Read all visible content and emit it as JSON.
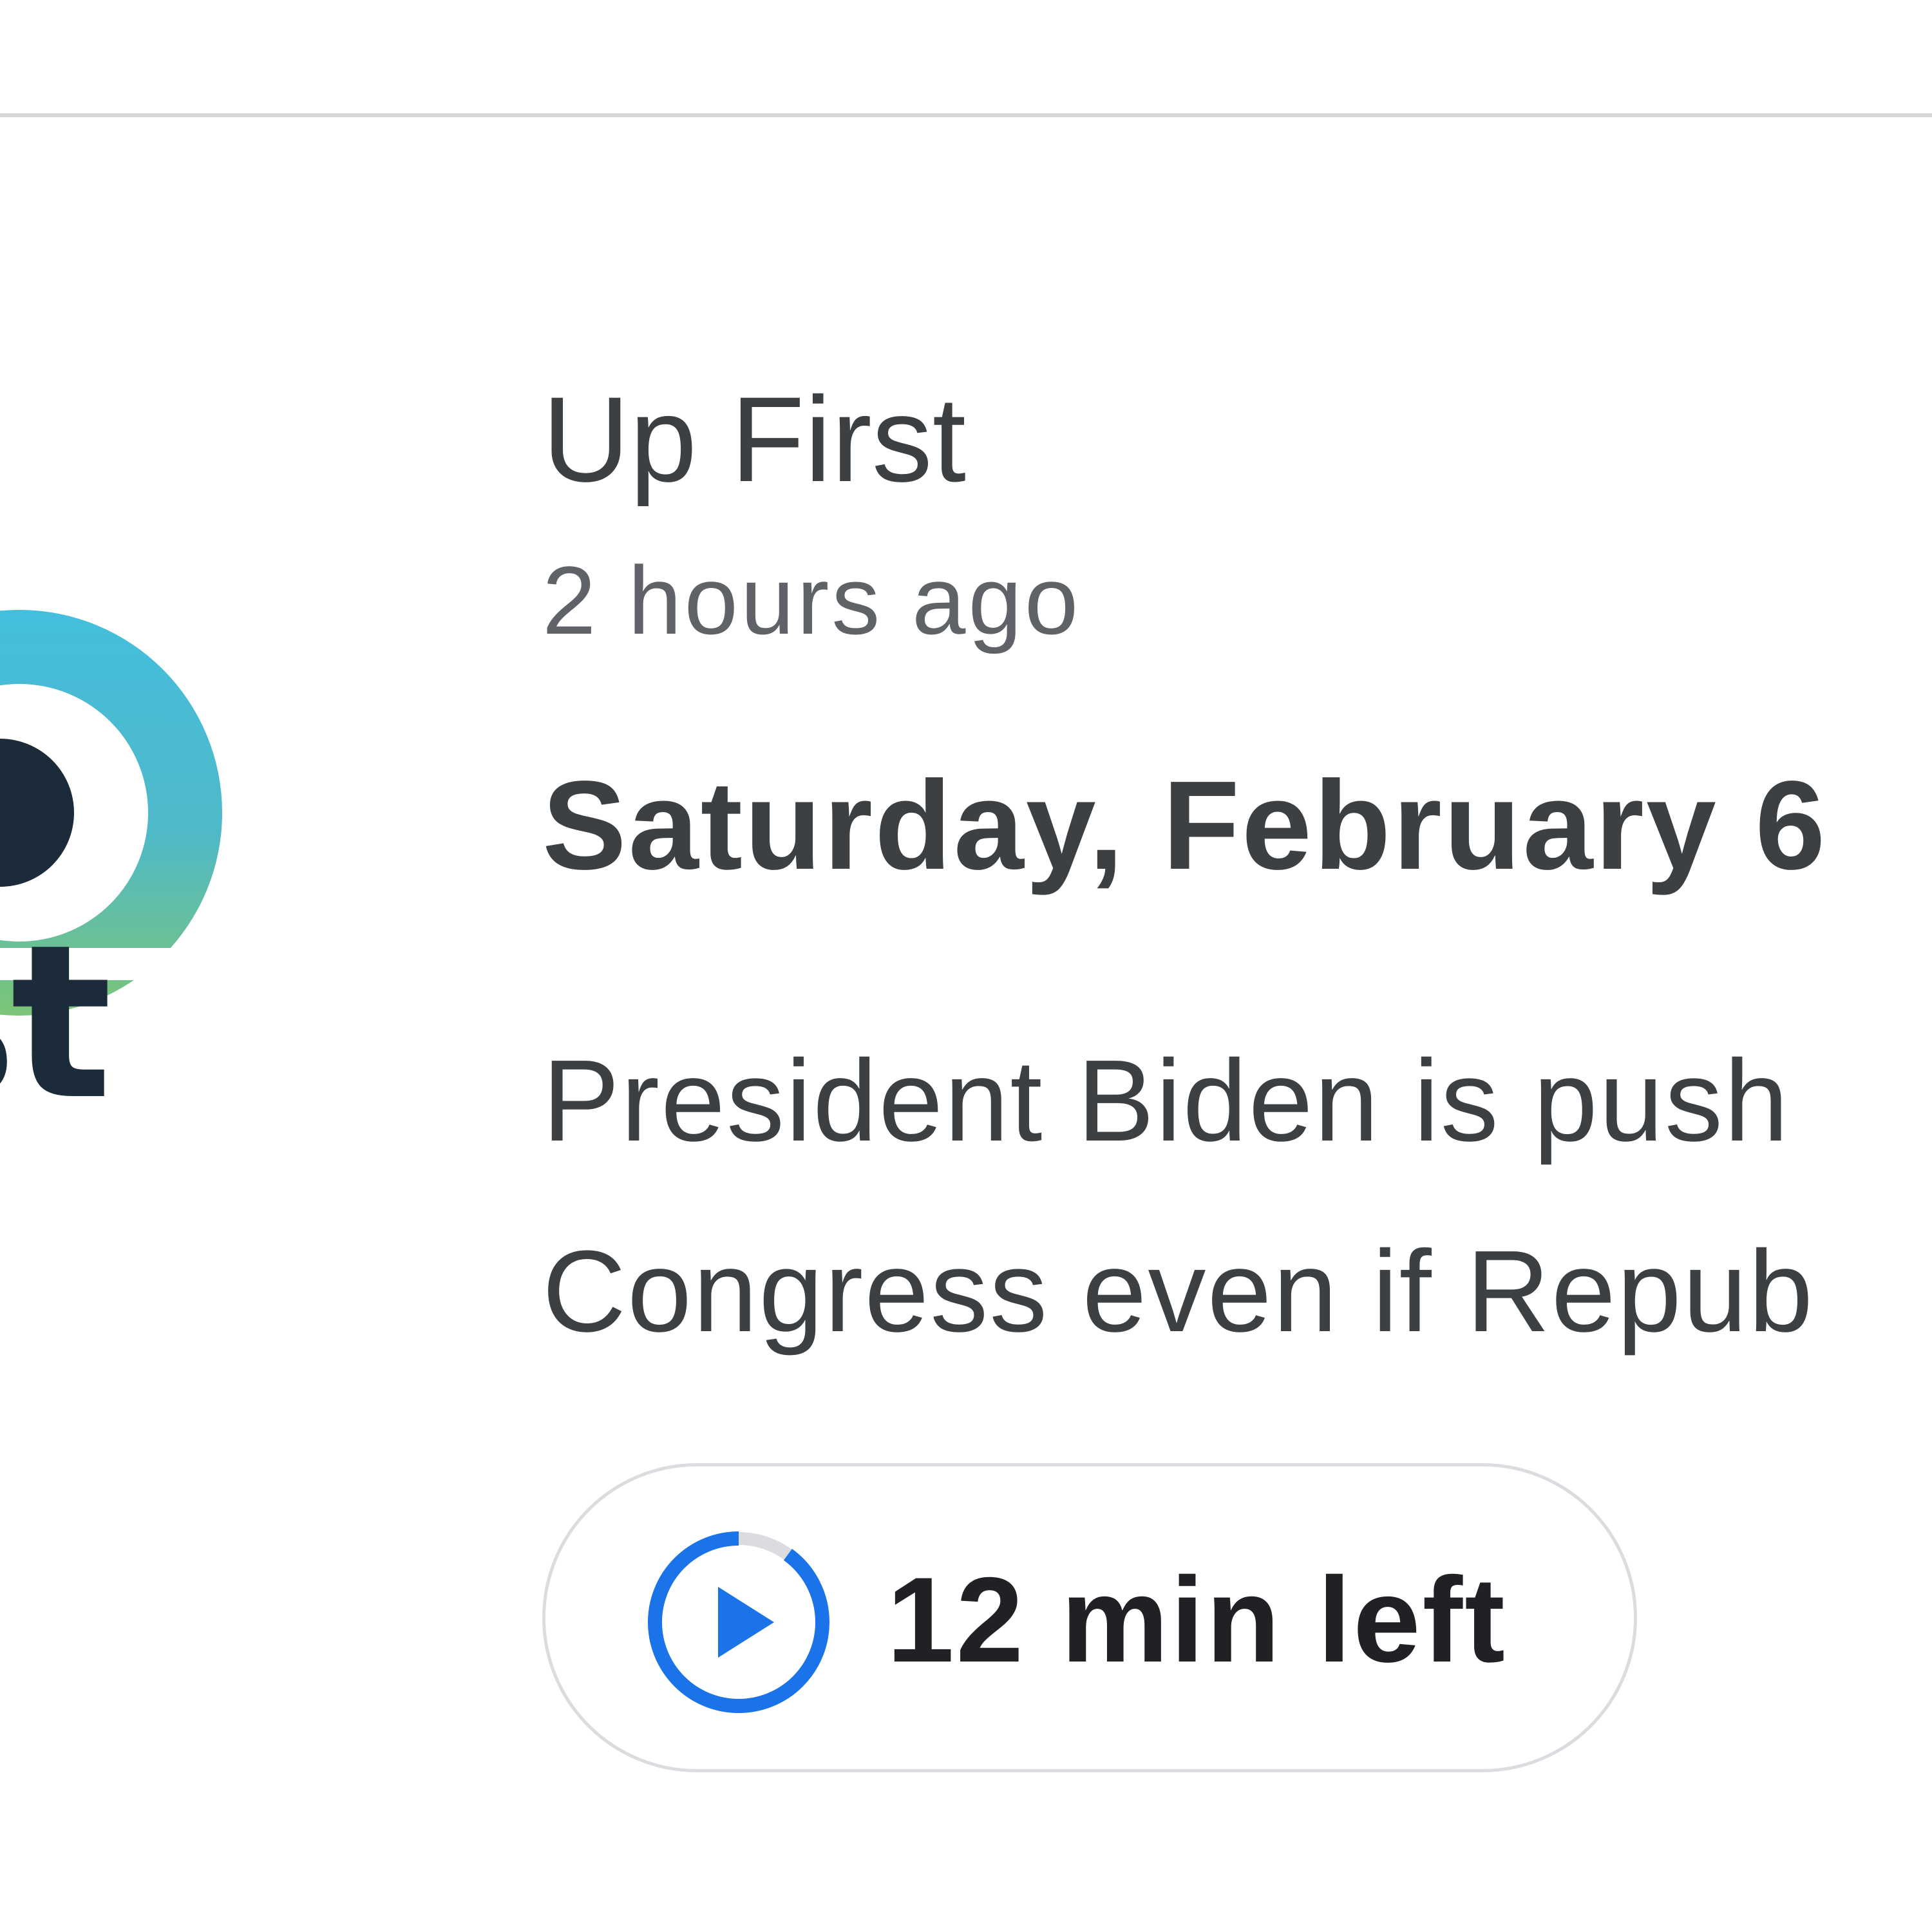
{
  "episode": {
    "show_name": "Up First",
    "published": "2 hours ago",
    "title": "Saturday, February 6",
    "description_lines": [
      "President Biden is push",
      "Congress even if Repub"
    ],
    "remaining_label": "12 min left",
    "progress_fraction": 0.1
  },
  "artwork": {
    "logo_text_fragment": "st"
  },
  "icons": {
    "play": "play-progress-icon"
  },
  "colors": {
    "accent": "#1a73e8",
    "text_primary": "#3c4043",
    "text_secondary": "#5f6368",
    "logo_ring": "#3fb8d6",
    "logo_green": "#7cc576",
    "logo_text": "#1c2b39"
  }
}
